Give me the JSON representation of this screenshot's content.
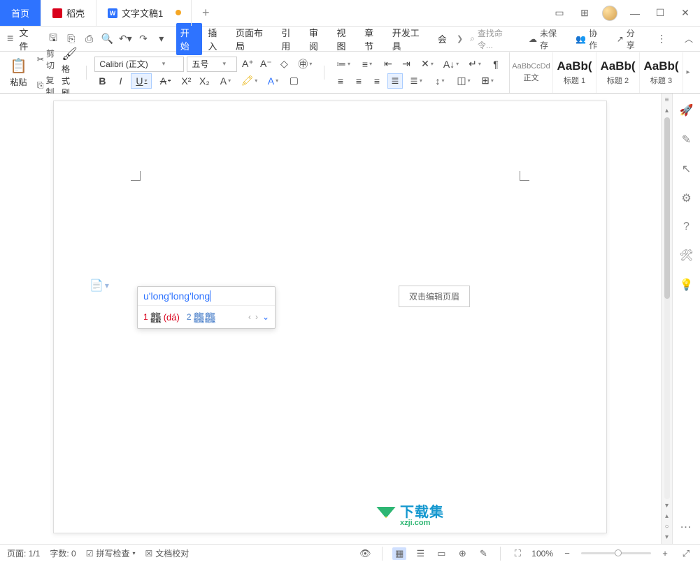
{
  "tabs": {
    "home": "首页",
    "docer": "稻壳",
    "doc": "文字文稿1"
  },
  "menu": {
    "file": "文件"
  },
  "mtabs": {
    "start": "开始",
    "insert": "插入",
    "layout": "页面布局",
    "ref": "引用",
    "review": "审阅",
    "view": "视图",
    "chapter": "章节",
    "dev": "开发工具",
    "member": "会"
  },
  "search_ph": "查找命令...",
  "cloud": {
    "unsaved": "未保存",
    "collab": "协作",
    "share": "分享"
  },
  "clip": {
    "paste": "粘贴",
    "cut": "剪切",
    "copy": "复制",
    "fmt": "格式刷"
  },
  "font": {
    "name": "Calibri (正文)",
    "size": "五号"
  },
  "styles": [
    {
      "prev": "AaBbCcDd",
      "label": "正文",
      "big": false
    },
    {
      "prev": "AaBb(",
      "label": "标题 1",
      "big": true
    },
    {
      "prev": "AaBb(",
      "label": "标题 2",
      "big": true
    },
    {
      "prev": "AaBb(",
      "label": "标题 3",
      "big": true
    }
  ],
  "header_hint": "双击编辑页眉",
  "ime": {
    "input": "u'long'long'long",
    "c1_char": "龘",
    "c1_py": "(dá)",
    "c2_char": "龘龘"
  },
  "watermark": {
    "main": "下载集",
    "sub": "xzji.com"
  },
  "status": {
    "page": "页面: 1/1",
    "words": "字数: 0",
    "spell": "拼写检查",
    "proof": "文档校对",
    "zoom": "100%"
  }
}
